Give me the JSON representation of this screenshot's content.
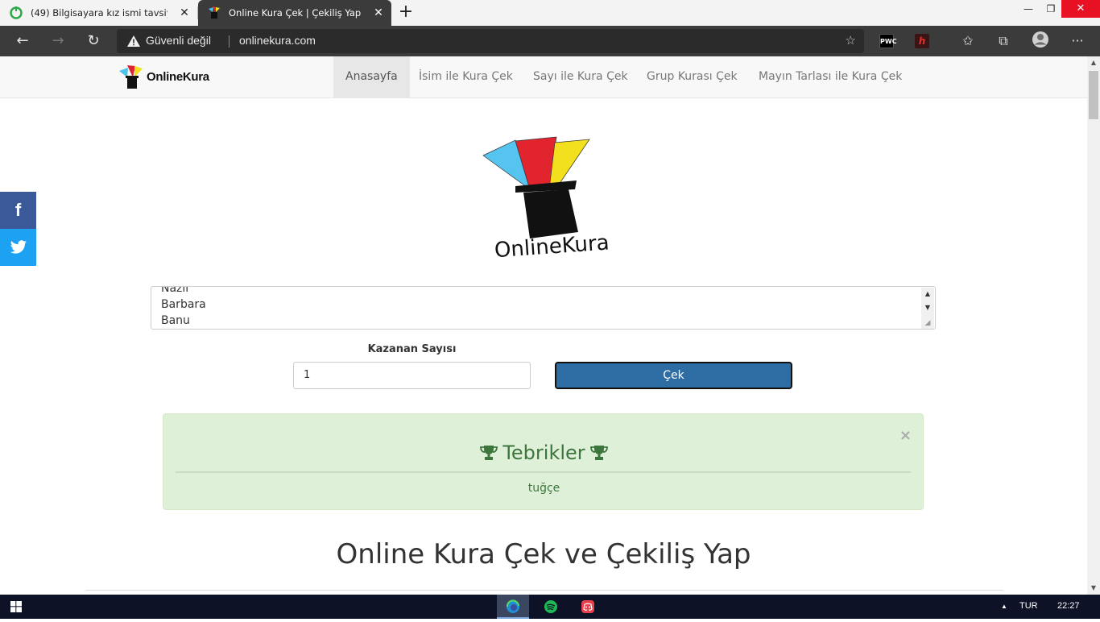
{
  "browser": {
    "tabs": [
      {
        "title": "(49) Bilgisayara kız ismi tavsiyesi |",
        "active": false
      },
      {
        "title": "Online Kura Çek | Çekiliş Yap",
        "active": true
      }
    ],
    "security_label": "Güvenli değil",
    "url": "onlinekura.com"
  },
  "site": {
    "logo_text": "OnlineKura",
    "nav": [
      {
        "label": "Anasayfa",
        "active": true
      },
      {
        "label": "İsim ile Kura Çek"
      },
      {
        "label": "Sayı ile Kura Çek"
      },
      {
        "label": "Grup Kurası Çek"
      },
      {
        "label": "Mayın Tarlası ile Kura Çek"
      }
    ],
    "big_logo_text": "OnlineKura"
  },
  "social": {
    "facebook": "f",
    "twitter": "t"
  },
  "form": {
    "names_lines": [
      "Nazlı",
      "Barbara",
      "Banu"
    ],
    "winner_count_label": "Kazanan Sayısı",
    "winner_count_value": "1",
    "draw_button": "Çek"
  },
  "result": {
    "title": "Tebrikler",
    "winner": "tuğçe",
    "close": "×"
  },
  "heading": "Online Kura Çek ve Çekiliş Yap",
  "taskbar": {
    "language": "TUR",
    "time": "22:27"
  },
  "colors": {
    "primary_button": "#2e6da4",
    "alert_bg": "#dff0d8",
    "alert_text": "#3c763d",
    "facebook": "#3b5998",
    "twitter": "#1da1f2"
  }
}
